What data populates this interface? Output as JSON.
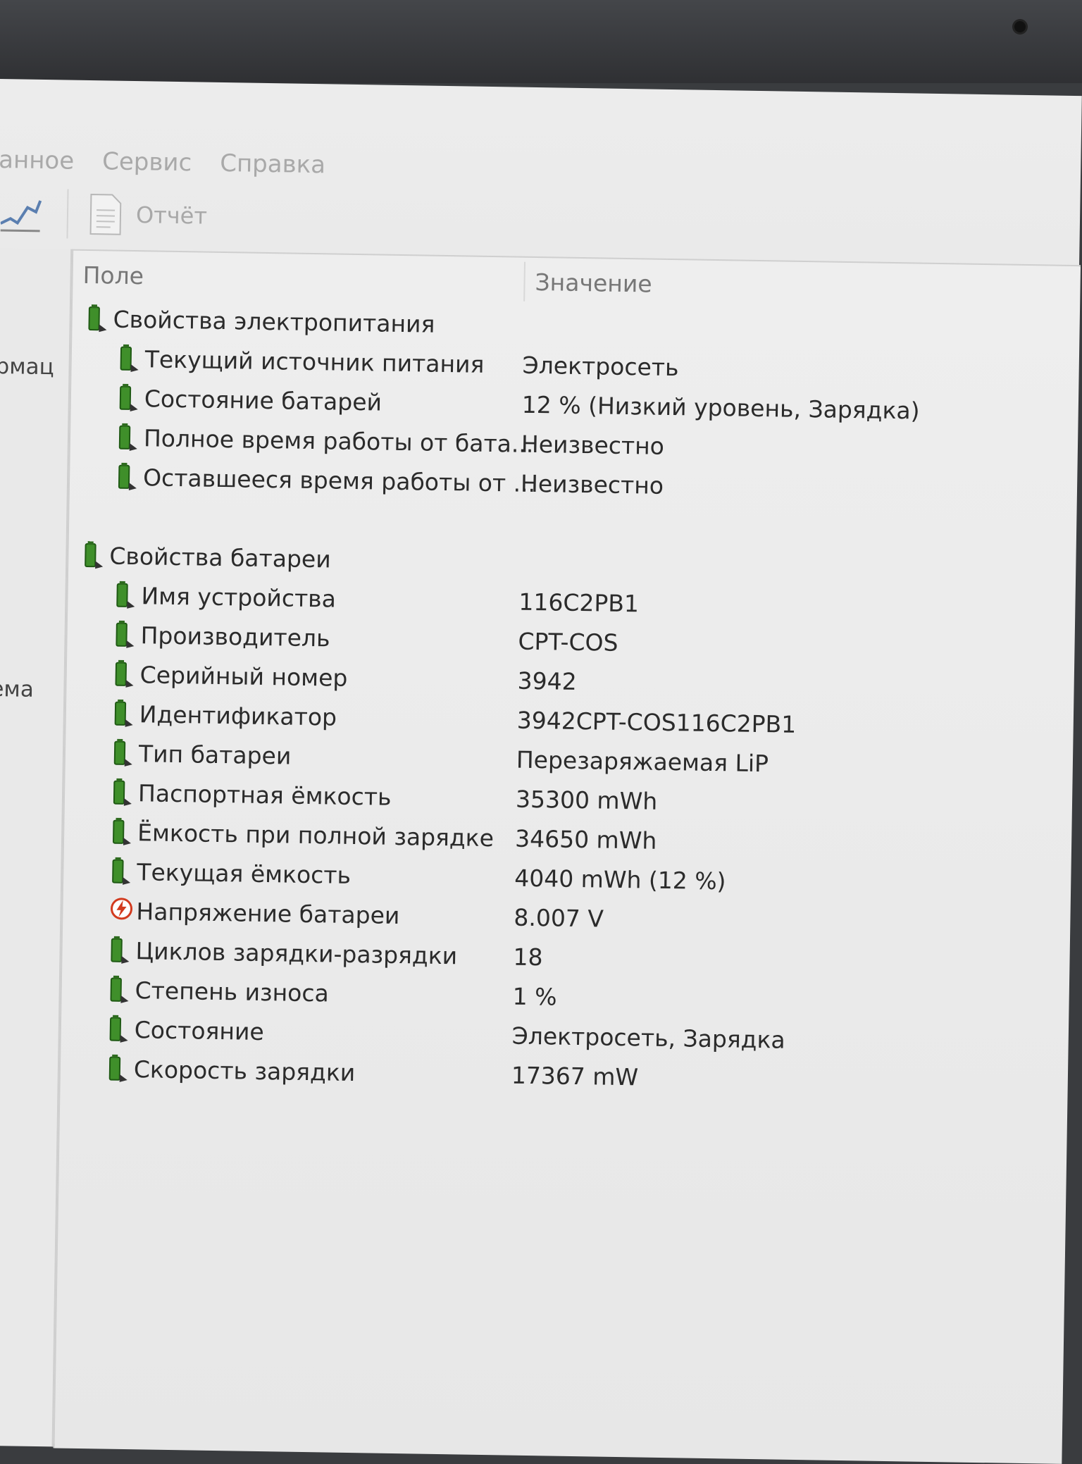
{
  "menu": [
    "анное",
    "Сервис",
    "Справка"
  ],
  "toolbar": {
    "report_label": "Отчёт"
  },
  "left_pane": [
    "рмац",
    "ема"
  ],
  "columns": {
    "field": "Поле",
    "value": "Значение"
  },
  "groups": [
    {
      "title": "Свойства электропитания",
      "rows": [
        {
          "field": "Текущий источник питания",
          "value": "Электросеть",
          "icon": "battery-icon"
        },
        {
          "field": "Состояние батарей",
          "value": "12 % (Низкий уровень, Зарядка)",
          "icon": "battery-icon"
        },
        {
          "field": "Полное время работы от бата...",
          "value": "Неизвестно",
          "icon": "battery-icon"
        },
        {
          "field": "Оставшееся время работы от ...",
          "value": "Неизвестно",
          "icon": "battery-icon"
        }
      ]
    },
    {
      "title": "Свойства батареи",
      "rows": [
        {
          "field": "Имя устройства",
          "value": "116C2PB1",
          "icon": "battery-icon"
        },
        {
          "field": "Производитель",
          "value": "CPT-COS",
          "icon": "battery-icon"
        },
        {
          "field": "Серийный номер",
          "value": "3942",
          "icon": "battery-icon"
        },
        {
          "field": "Идентификатор",
          "value": "3942CPT-COS116C2PB1",
          "icon": "battery-icon"
        },
        {
          "field": "Тип батареи",
          "value": "Перезаряжаемая LiP",
          "icon": "battery-icon"
        },
        {
          "field": "Паспортная ёмкость",
          "value": "35300 mWh",
          "icon": "battery-icon"
        },
        {
          "field": "Ёмкость при полной зарядке",
          "value": "34650 mWh",
          "icon": "battery-icon"
        },
        {
          "field": "Текущая ёмкость",
          "value": "4040 mWh  (12 %)",
          "icon": "battery-icon"
        },
        {
          "field": "Напряжение батареи",
          "value": "8.007 V",
          "icon": "voltage-icon"
        },
        {
          "field": "Циклов зарядки-разрядки",
          "value": "18",
          "icon": "battery-icon"
        },
        {
          "field": "Степень износа",
          "value": "1 %",
          "icon": "battery-icon"
        },
        {
          "field": "Состояние",
          "value": "Электросеть, Зарядка",
          "icon": "battery-icon"
        },
        {
          "field": "Скорость зарядки",
          "value": "17367 mW",
          "icon": "battery-icon"
        }
      ]
    }
  ],
  "colors": {
    "battery_green": "#3f8f2a",
    "voltage_red": "#d23a1e"
  }
}
